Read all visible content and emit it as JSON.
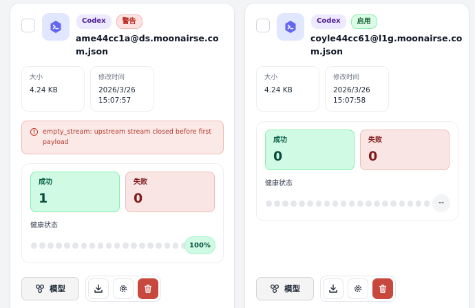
{
  "accounts": [
    {
      "provider": "Codex",
      "status": "警告",
      "status_type": "warn",
      "email": "ame44cc1a@ds.moonairse.com.json",
      "size_label": "大小",
      "size_value": "4.24 KB",
      "mtime_label": "修改时间",
      "mtime_date": "2026/3/26",
      "mtime_time": "15:07:57",
      "error": "empty_stream: upstream stream closed before first payload",
      "success_label": "成功",
      "success_value": "1",
      "fail_label": "失败",
      "fail_value": "0",
      "health_label": "健康状态",
      "health_dots_total": 20,
      "health_dots_on": 1,
      "health_value": "100%",
      "model_label": "模型"
    },
    {
      "provider": "Codex",
      "status": "启用",
      "status_type": "on",
      "email": "coyle44cc61@l1g.moonairse.com.json",
      "size_label": "大小",
      "size_value": "4.24 KB",
      "mtime_label": "修改时间",
      "mtime_date": "2026/3/26",
      "mtime_time": "15:07:58",
      "success_label": "成功",
      "success_value": "0",
      "fail_label": "失败",
      "fail_value": "0",
      "health_label": "健康状态",
      "health_dots_total": 20,
      "health_dots_on": 0,
      "health_value": "--",
      "model_label": "模型"
    }
  ],
  "colors": {
    "success_bg": "#d1fae5",
    "fail_bg": "#f9e5e3",
    "danger": "#c9483d",
    "health_on": "#22c55e"
  },
  "icons": {
    "app": "codex-app-icon",
    "download": "download-icon",
    "settings": "gear-icon",
    "delete": "trash-icon",
    "model": "model-nodes-icon",
    "error": "alert-circle-icon"
  }
}
